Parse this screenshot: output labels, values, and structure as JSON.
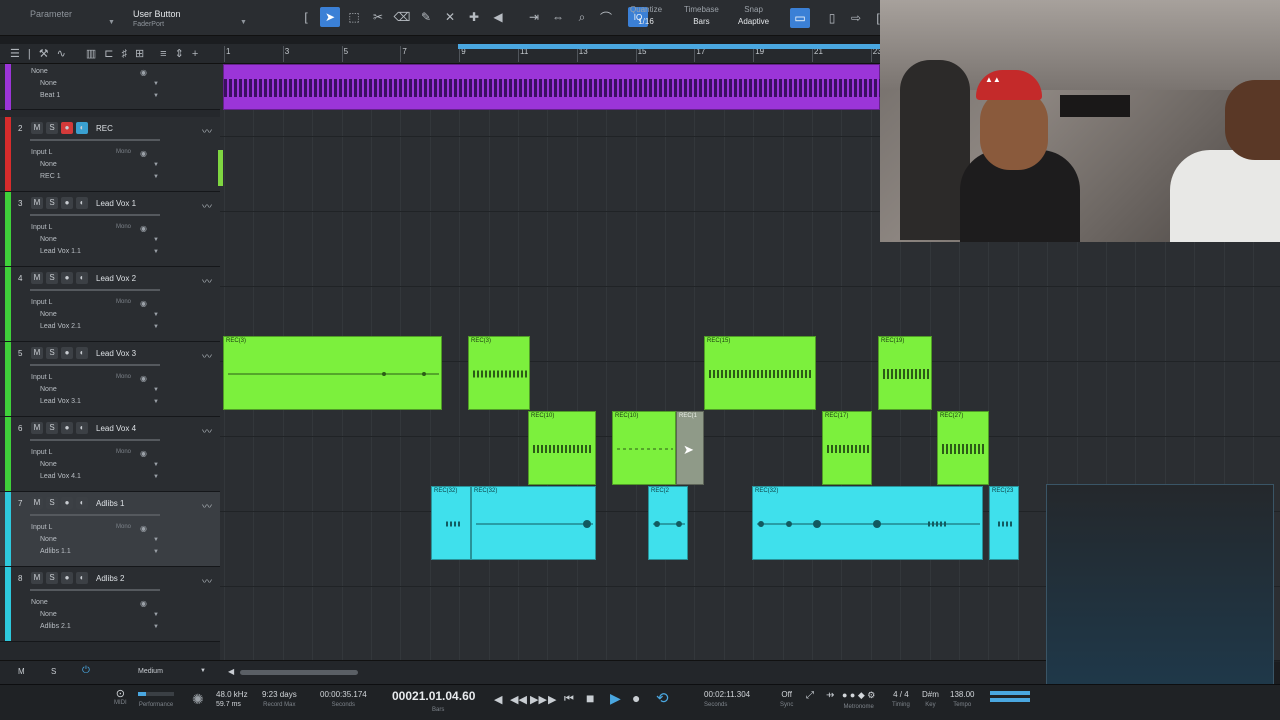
{
  "toolbar": {
    "parameter_label": "Parameter",
    "parameter_value": "User Button",
    "parameter_sub": "FaderPort",
    "quantize_label": "Quantize",
    "quantize_value": "1/16",
    "timebase_label": "Timebase",
    "timebase_value": "Bars",
    "snap_label": "Snap",
    "snap_value": "Adaptive",
    "iq_label": "IQ"
  },
  "ruler": {
    "numbers": [
      "1",
      "3",
      "5",
      "7",
      "9",
      "11",
      "13",
      "15",
      "17",
      "19",
      "21",
      "23"
    ]
  },
  "tracks": [
    {
      "num": "1",
      "name": "",
      "color": "#9b35d8",
      "input": "None",
      "sub2": "None",
      "channel": "Beat 1"
    },
    {
      "num": "2",
      "name": "REC",
      "color": "#d62c2c",
      "input": "Input L",
      "sub2": "None",
      "channel": "REC 1",
      "mono": "Mono"
    },
    {
      "num": "3",
      "name": "Lead Vox 1",
      "color": "#3fd03a",
      "input": "Input L",
      "sub2": "None",
      "channel": "Lead Vox 1.1",
      "mono": "Mono"
    },
    {
      "num": "4",
      "name": "Lead Vox 2",
      "color": "#3fd03a",
      "input": "Input L",
      "sub2": "None",
      "channel": "Lead Vox 2.1",
      "mono": "Mono"
    },
    {
      "num": "5",
      "name": "Lead Vox 3",
      "color": "#3fd03a",
      "input": "Input L",
      "sub2": "None",
      "channel": "Lead Vox 3.1",
      "mono": "Mono"
    },
    {
      "num": "6",
      "name": "Lead Vox 4",
      "color": "#3fd03a",
      "input": "Input L",
      "sub2": "None",
      "channel": "Lead Vox 4.1",
      "mono": "Mono"
    },
    {
      "num": "7",
      "name": "Adlibs 1",
      "color": "#2ec8dc",
      "input": "Input L",
      "sub2": "None",
      "channel": "Adlibs 1.1",
      "mono": "Mono"
    },
    {
      "num": "8",
      "name": "Adlibs 2",
      "color": "#2ec8dc",
      "input": "None",
      "sub2": "None",
      "channel": "Adlibs 2.1"
    }
  ],
  "track_buttons": {
    "mute": "M",
    "solo": "S"
  },
  "clips": {
    "c1": "REC(3)",
    "c2": "REC(3)",
    "c3": "REC(15)",
    "c4": "REC(19)",
    "c5": "REC(10)",
    "c6": "REC(10)",
    "c7": "REC(1",
    "c8": "REC(17)",
    "c9": "REC(27)",
    "c10": "REC(32)",
    "c11": "REC(32)",
    "c12": "REC(2",
    "c13": "REC(32)",
    "c14": "REC(23"
  },
  "bottom": {
    "m": "M",
    "s": "S",
    "zoom": "Medium"
  },
  "transport": {
    "midi": "MIDI",
    "performance": "Performance",
    "sample_rate": "48.0 kHz",
    "latency": "59.7 ms",
    "record_days": "9:23 days",
    "record_max": "Record Max",
    "seconds_time": "00:00:35.174",
    "seconds_label": "Seconds",
    "bars_time": "00021.01.04.60",
    "bars_label": "Bars",
    "right_time": "00:02:11.304",
    "right_label": "Seconds",
    "sync_value": "Off",
    "sync_label": "Sync",
    "metronome_label": "Metronome",
    "timing_value": "4 / 4",
    "timing_label": "Timing",
    "key_value": "D#m",
    "key_label": "Key",
    "tempo_value": "138.00",
    "tempo_label": "Tempo"
  },
  "colors": {
    "clip_green": "#7cf03d",
    "clip_cyan": "#3fe0ec",
    "clip_purple": "#9b35d8",
    "accent_blue": "#3b80d6"
  },
  "icons": [
    "arrow-tool-icon",
    "range-tool-icon",
    "split-tool-icon",
    "eraser-icon",
    "paint-icon",
    "mute-tool-icon",
    "bend-icon",
    "listen-icon",
    "play-icon",
    "stop-icon",
    "record-icon",
    "loop-icon",
    "rewind-icon",
    "forward-icon"
  ]
}
